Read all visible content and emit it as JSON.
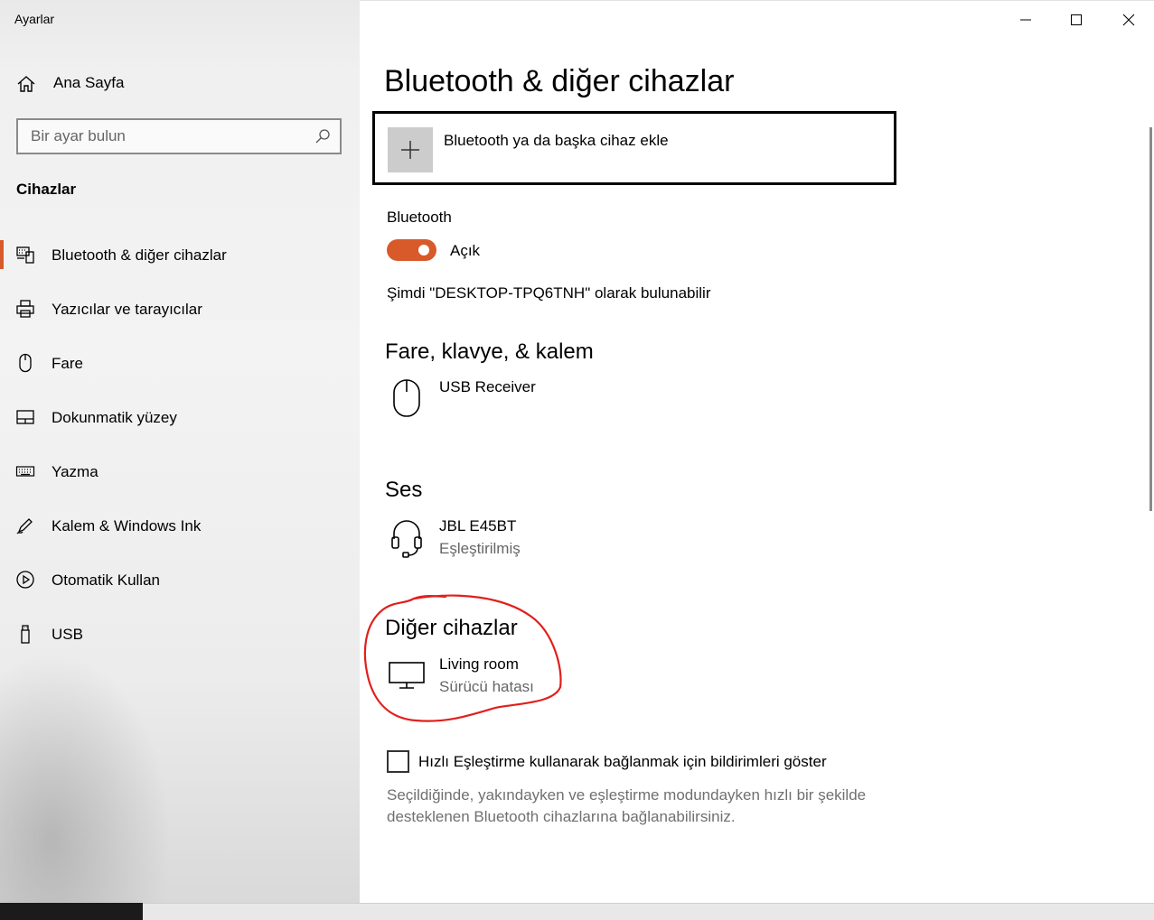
{
  "app": {
    "title": "Ayarlar"
  },
  "sidebar": {
    "home_label": "Ana Sayfa",
    "search_placeholder": "Bir ayar bulun",
    "section_title": "Cihazlar",
    "items": [
      {
        "label": "Bluetooth & diğer cihazlar",
        "icon": "bluetooth-devices-icon",
        "active": true
      },
      {
        "label": "Yazıcılar ve tarayıcılar",
        "icon": "printer-icon",
        "active": false
      },
      {
        "label": "Fare",
        "icon": "mouse-icon",
        "active": false
      },
      {
        "label": "Dokunmatik yüzey",
        "icon": "touchpad-icon",
        "active": false
      },
      {
        "label": "Yazma",
        "icon": "keyboard-icon",
        "active": false
      },
      {
        "label": "Kalem & Windows Ink",
        "icon": "pen-icon",
        "active": false
      },
      {
        "label": "Otomatik Kullan",
        "icon": "autoplay-icon",
        "active": false
      },
      {
        "label": "USB",
        "icon": "usb-icon",
        "active": false
      }
    ]
  },
  "main": {
    "title": "Bluetooth & diğer cihazlar",
    "add_device_label": "Bluetooth ya da başka cihaz ekle",
    "bluetooth": {
      "label": "Bluetooth",
      "state_label": "Açık",
      "enabled": true,
      "discoverable_text": "Şimdi \"DESKTOP-TPQ6TNH\" olarak bulunabilir"
    },
    "sections": {
      "input": {
        "title": "Fare, klavye, & kalem",
        "devices": [
          {
            "name": "USB Receiver",
            "status": ""
          }
        ]
      },
      "audio": {
        "title": "Ses",
        "devices": [
          {
            "name": "JBL E45BT",
            "status": "Eşleştirilmiş"
          }
        ]
      },
      "other": {
        "title": "Diğer cihazlar",
        "devices": [
          {
            "name": "Living room",
            "status": "Sürücü hatası"
          }
        ]
      }
    },
    "swift_pair": {
      "label": "Hızlı Eşleştirme kullanarak bağlanmak için bildirimleri göster",
      "checked": false,
      "description": "Seçildiğinde, yakındayken ve eşleştirme modundayken hızlı bir şekilde desteklenen Bluetooth cihazlarına bağlanabilirsiniz."
    }
  },
  "colors": {
    "accent": "#d85a2a",
    "annotation": "#e0201c",
    "secondary_text": "#666666"
  }
}
